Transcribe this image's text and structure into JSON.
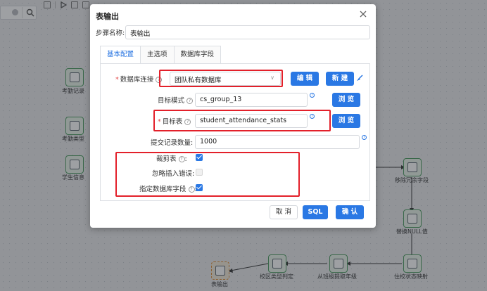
{
  "canvas": {
    "nodes": [
      {
        "label": "考勤记录"
      },
      {
        "label": "考勤类型"
      },
      {
        "label": "学生信息"
      },
      {
        "label": "移除冗余字段"
      },
      {
        "label": "替换NULL值"
      },
      {
        "label": "住校状态映射"
      },
      {
        "label": "从班级提取年级"
      },
      {
        "label": "校区类型判定"
      },
      {
        "label": "表输出"
      }
    ]
  },
  "dialog": {
    "title": "表输出",
    "step_name_label": "步骤名称:",
    "step_name_value": "表输出",
    "tabs": [
      {
        "label": "基本配置"
      },
      {
        "label": "主选项"
      },
      {
        "label": "数据库字段"
      }
    ],
    "db_connection_label": "数据库连接",
    "db_connection_value": "团队私有数据库",
    "edit_button": "编 辑",
    "new_button": "新 建",
    "target_schema_label": "目标模式",
    "target_schema_value": "cs_group_13",
    "browse_button": "浏 览",
    "target_table_label": "目标表",
    "target_table_value": "student_attendance_stats",
    "commit_size_label": "提交记录数量:",
    "commit_size_value": "1000",
    "truncate_label": "裁剪表",
    "truncate_checked": true,
    "ignore_errors_label": "忽略插入错误:",
    "ignore_errors_checked": false,
    "specify_fields_label": "指定数据库字段",
    "specify_fields_checked": true,
    "cancel_button": "取 消",
    "sql_button": "SQL",
    "confirm_button": "确 认",
    "help_glyph": "?",
    "info_glyph": "i",
    "required_mark": "*",
    "colon": ":"
  }
}
